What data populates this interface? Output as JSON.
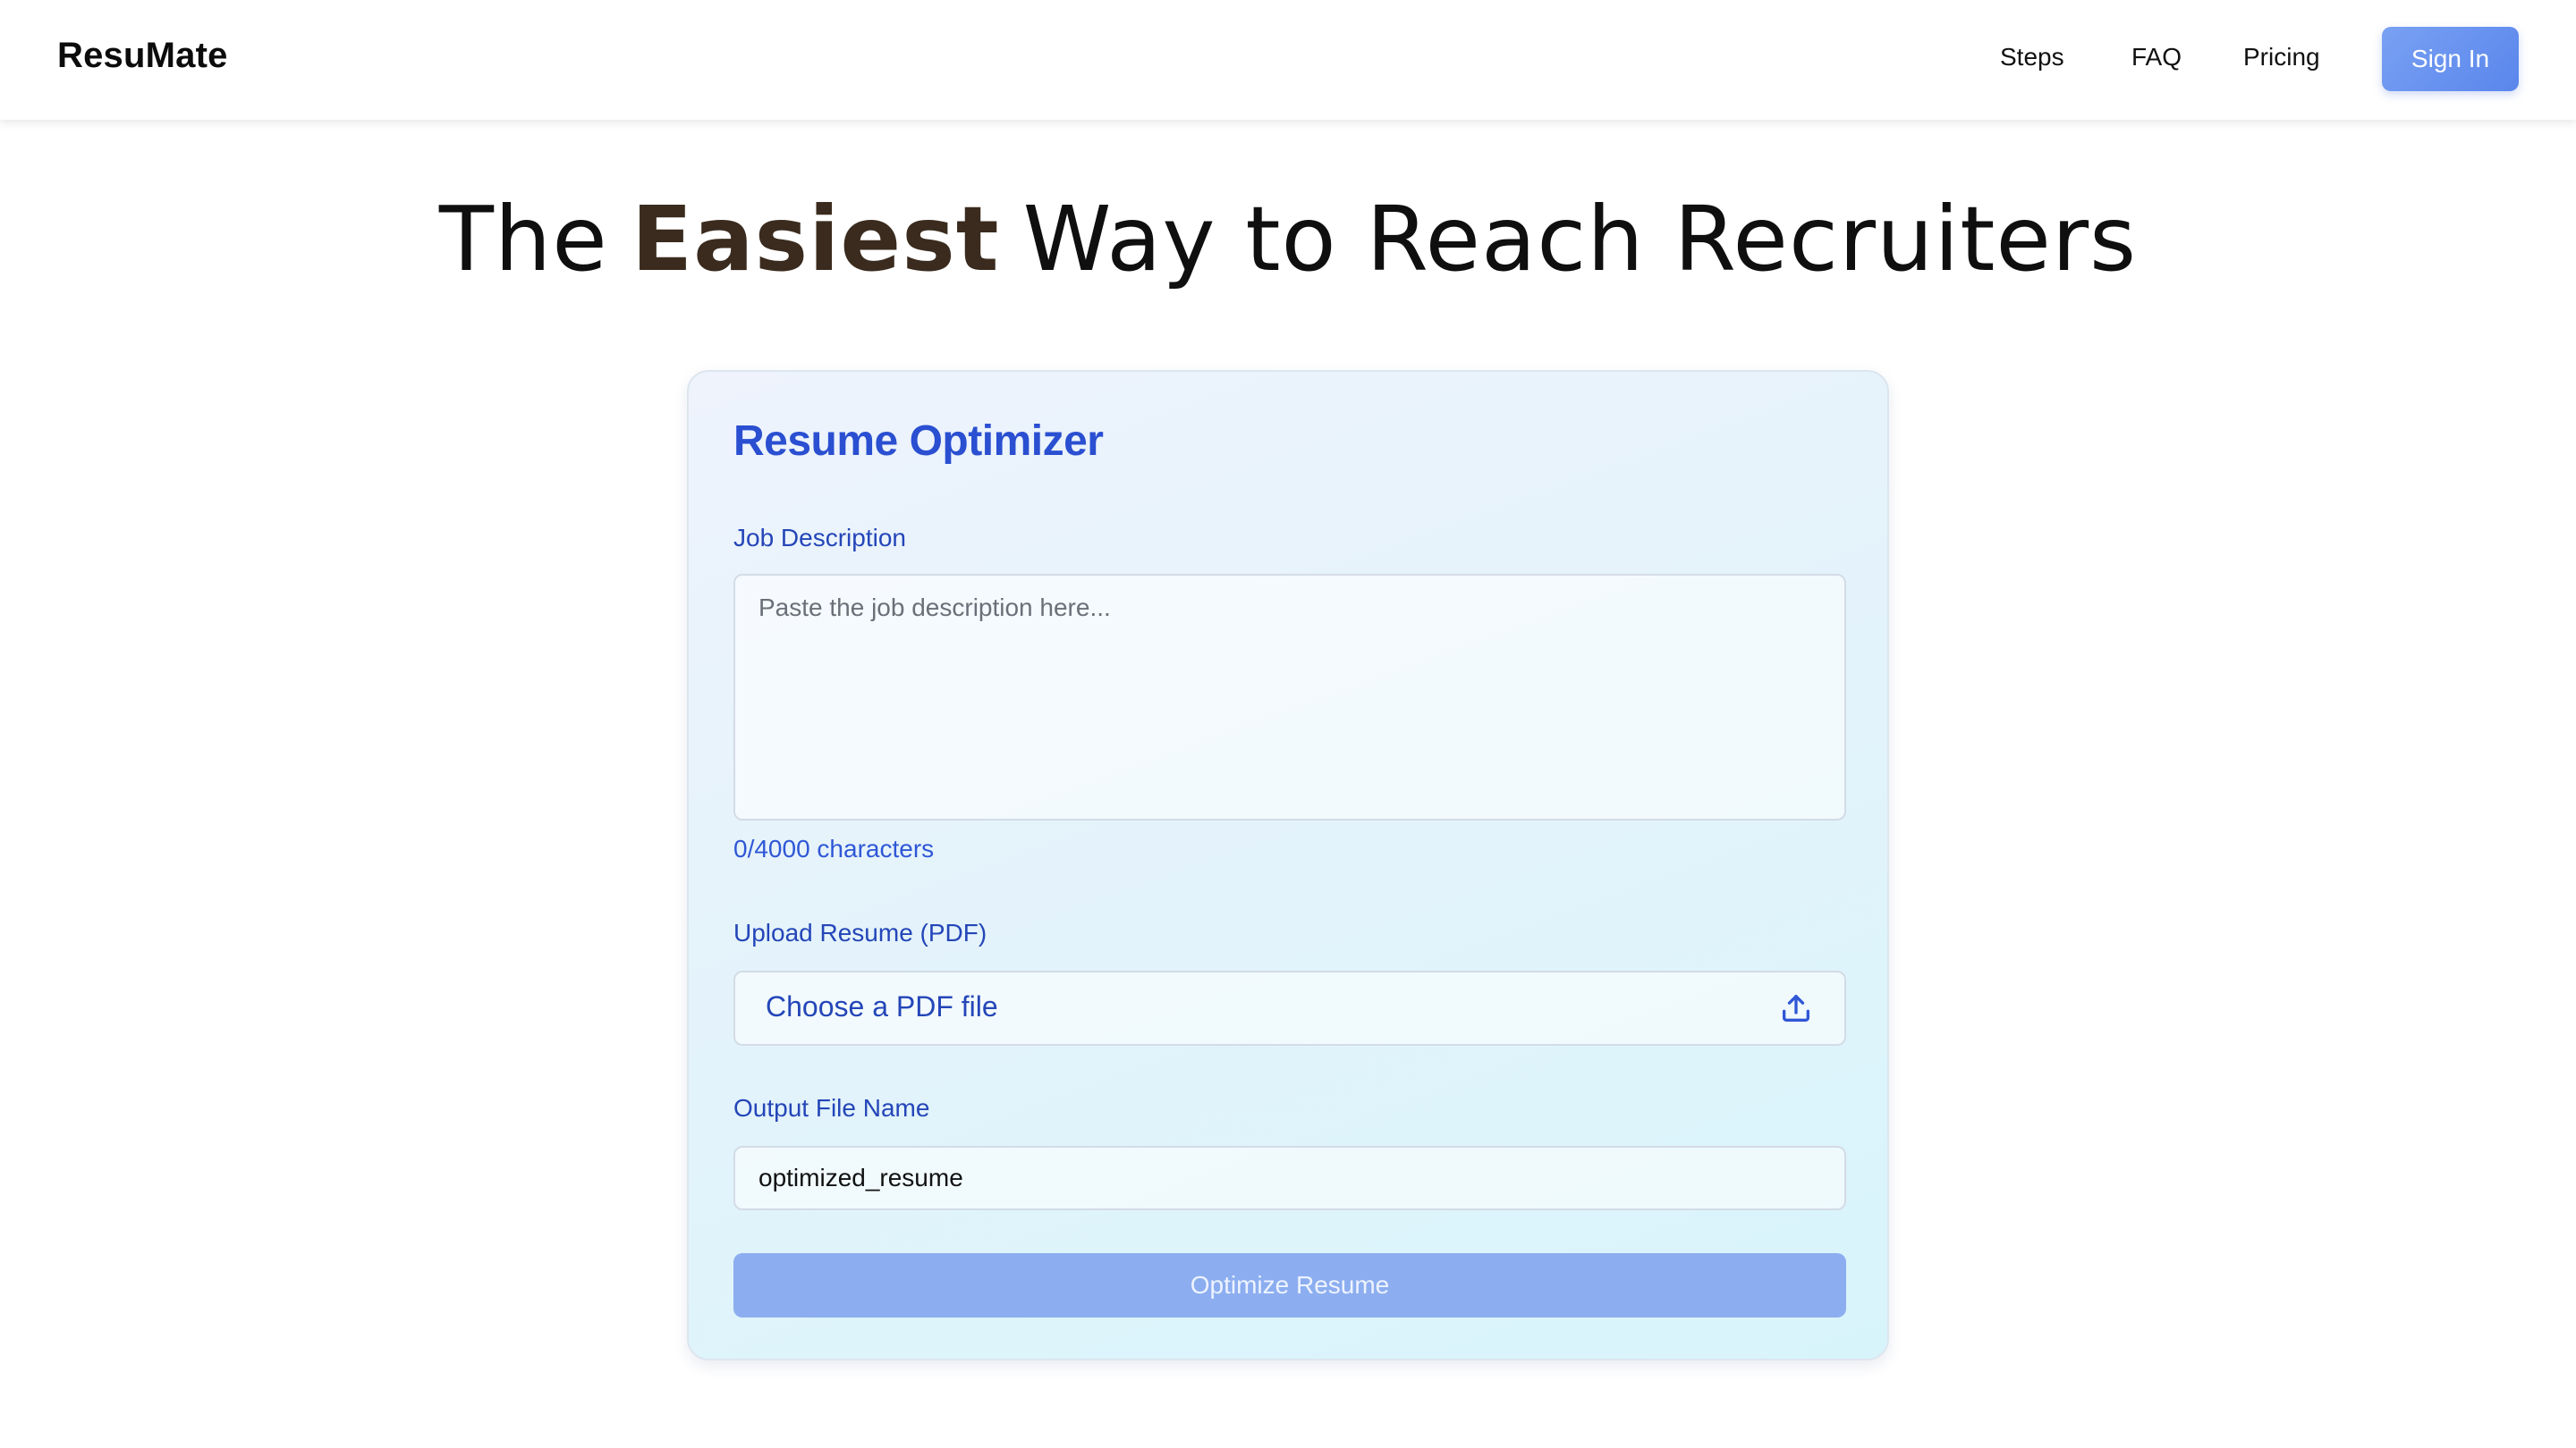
{
  "header": {
    "brand": "ResuMate",
    "nav": {
      "steps": "Steps",
      "faq": "FAQ",
      "pricing": "Pricing"
    },
    "sign_in": "Sign In"
  },
  "hero": {
    "prefix": "The",
    "highlight": "Easiest",
    "suffix": "Way to Reach Recruiters"
  },
  "card": {
    "title": "Resume Optimizer",
    "job_description": {
      "label": "Job Description",
      "placeholder": "Paste the job description here...",
      "value": "",
      "char_count": "0/4000 characters"
    },
    "upload": {
      "label": "Upload Resume (PDF)",
      "button_text": "Choose a PDF file",
      "icon": "upload-icon"
    },
    "output": {
      "label": "Output File Name",
      "value": "optimized_resume"
    },
    "submit": "Optimize Resume"
  },
  "colors": {
    "accent_blue": "#2a4fd1",
    "button_blue": "#5a86ec",
    "disabled_button": "#8caef0",
    "highlight_cyan": "#c6eef8"
  }
}
